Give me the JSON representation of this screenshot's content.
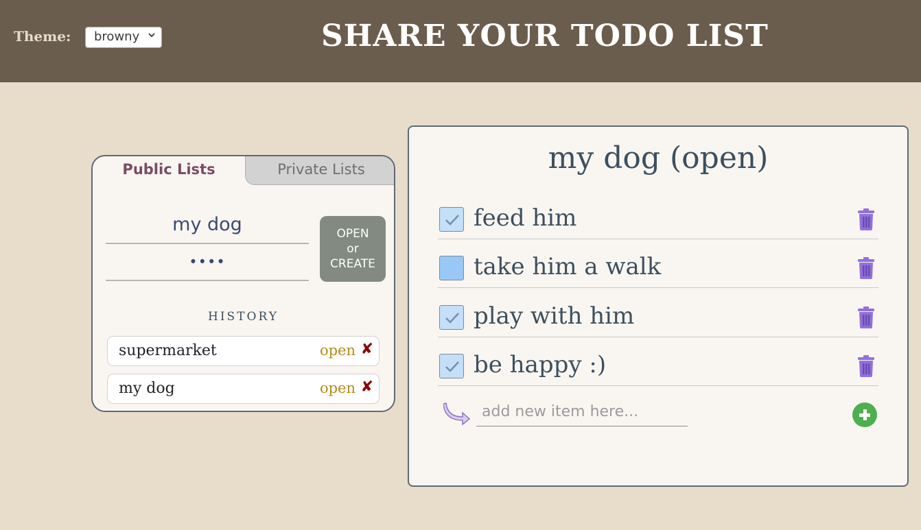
{
  "header": {
    "theme_label": "Theme:",
    "theme_value": "browny",
    "title": "SHARE YOUR TODO LIST"
  },
  "sidebar": {
    "tabs": [
      {
        "label": "Public Lists",
        "active": true
      },
      {
        "label": "Private Lists",
        "active": false
      }
    ],
    "list_name": "my dog",
    "password": "••••",
    "open_button": {
      "line1": "OPEN",
      "line2": "or",
      "line3": "CREATE"
    },
    "history_title": "HISTORY",
    "history": [
      {
        "name": "supermarket",
        "action": "open",
        "remove": "✘"
      },
      {
        "name": "my dog",
        "action": "open",
        "remove": "✘"
      }
    ]
  },
  "main": {
    "title": "my dog (open)",
    "items": [
      {
        "text": "feed him",
        "checked": true
      },
      {
        "text": "take him a walk",
        "checked": false
      },
      {
        "text": "play with him",
        "checked": true
      },
      {
        "text": "be happy :)",
        "checked": true
      }
    ],
    "add_placeholder": "add new item here..."
  },
  "icons": {
    "checkmark": "check-icon",
    "delete": "trash-icon",
    "add": "plus-circle-icon",
    "arrow": "curved-arrow-icon",
    "select": "chevron-down-icon"
  },
  "colors": {
    "header_bg": "#6b5d4d",
    "page_bg": "#e8dccb",
    "panel_bg": "#f9f6f2",
    "accent_open": "#b68b17",
    "remove_red": "#8b0000",
    "add_green": "#4caf50",
    "trash_purple": "#9370db"
  }
}
